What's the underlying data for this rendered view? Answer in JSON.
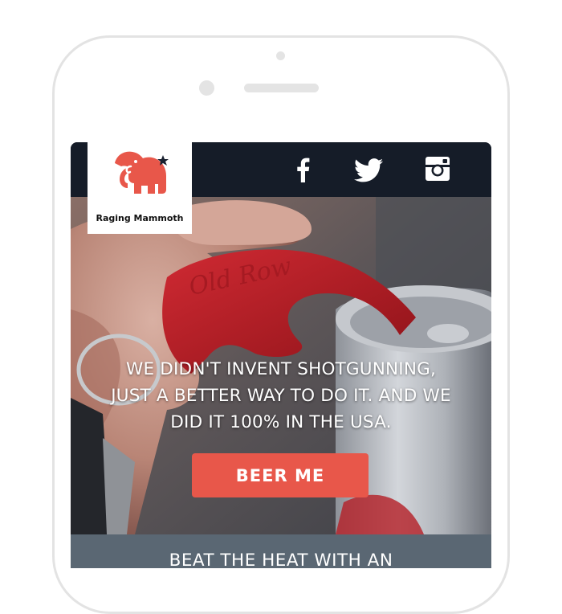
{
  "brand": {
    "name": "Raging Mammoth",
    "logo_color": "#e8574a",
    "star_color": "#1a2130"
  },
  "header": {
    "background": "#151c28",
    "social": [
      {
        "icon": "facebook-icon",
        "label": "f"
      },
      {
        "icon": "twitter-icon",
        "label": ""
      },
      {
        "icon": "instagram-icon",
        "label": ""
      }
    ]
  },
  "hero": {
    "headline_lines": [
      "WE DIDN'T INVENT SHOTGUNNING,",
      "JUST A BETTER WAY TO DO IT. AND WE",
      "DID IT 100% IN THE USA."
    ],
    "opener_engraving": "Old Row",
    "cta_label": "BEER ME",
    "cta_color": "#e8574a"
  },
  "next_section": {
    "teaser_text": "BEAT THE HEAT WITH AN"
  }
}
